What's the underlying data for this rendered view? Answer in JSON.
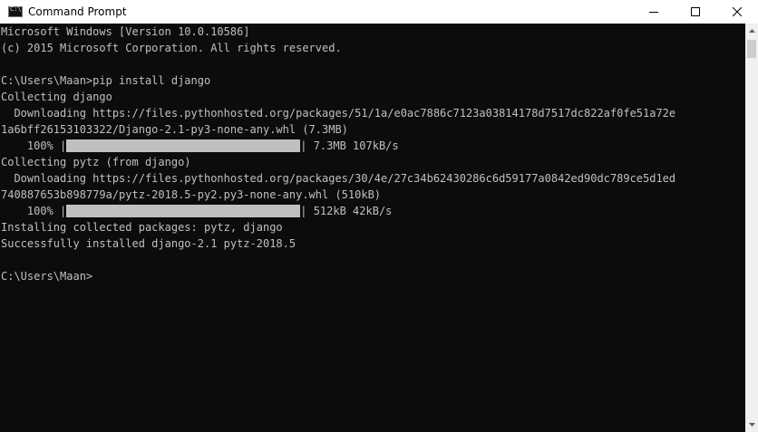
{
  "window": {
    "title": "Command Prompt",
    "icon": "cmd-console-icon",
    "controls": {
      "minimize_icon": "minimize-icon",
      "maximize_icon": "maximize-icon",
      "close_icon": "close-icon"
    }
  },
  "console": {
    "header": [
      "Microsoft Windows [Version 10.0.10586]",
      "(c) 2015 Microsoft Corporation. All rights reserved."
    ],
    "command": "C:\\Users\\Maan>pip install django",
    "collecting_django": "Collecting django",
    "download_django_1": "  Downloading https://files.pythonhosted.org/packages/51/1a/e0ac7886c7123a03814178d7517dc822af0fe51a72e",
    "download_django_2": "1a6bff26153103322/Django-2.1-py3-none-any.whl (7.3MB)",
    "progress_django": {
      "percent_label": "    100% |",
      "stats": "| 7.3MB 107kB/s",
      "fraction": 1.0
    },
    "collecting_pytz": "Collecting pytz (from django)",
    "download_pytz_1": "  Downloading https://files.pythonhosted.org/packages/30/4e/27c34b62430286c6d59177a0842ed90dc789ce5d1ed",
    "download_pytz_2": "740887653b898779a/pytz-2018.5-py2.py3-none-any.whl (510kB)",
    "progress_pytz": {
      "percent_label": "    100% |",
      "stats": "| 512kB 42kB/s",
      "fraction": 1.0
    },
    "installing": "Installing collected packages: pytz, django",
    "success": "Successfully installed django-2.1 pytz-2018.5",
    "prompt": "C:\\Users\\Maan>"
  },
  "colors": {
    "console_bg": "#0c0c0c",
    "console_text": "#c0c0c0",
    "titlebar_bg": "#ffffff"
  }
}
